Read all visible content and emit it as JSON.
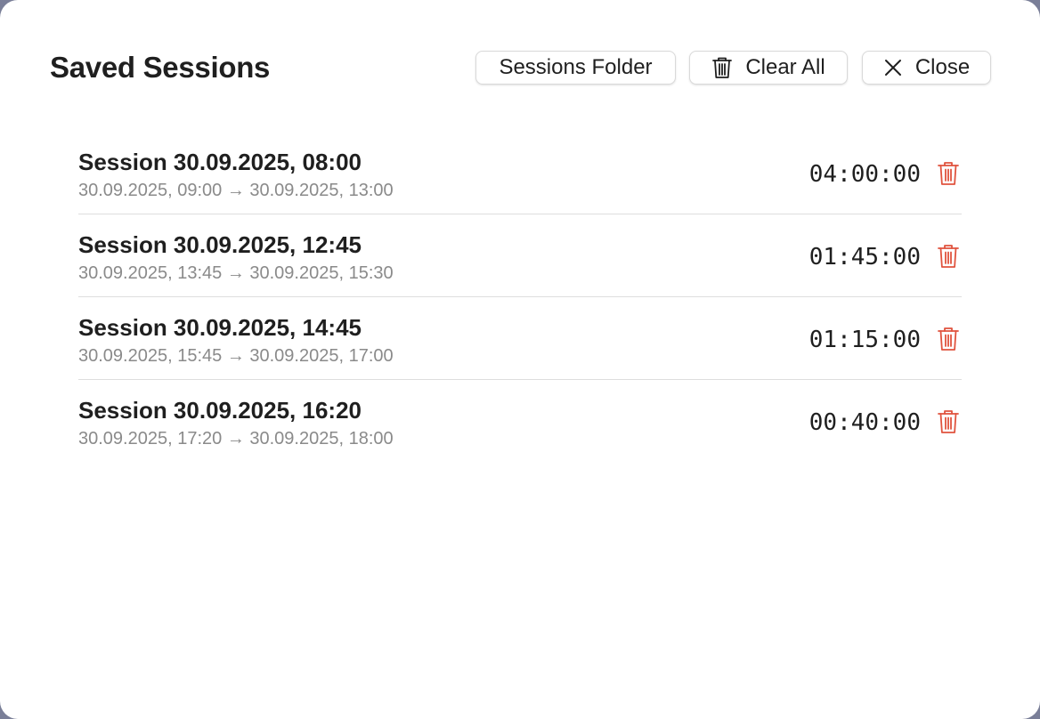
{
  "header": {
    "title": "Saved Sessions",
    "sessions_folder_label": "Sessions Folder",
    "clear_all_label": "Clear All",
    "close_label": "Close"
  },
  "icons": {
    "clear_all": "trash-icon",
    "close": "close-icon",
    "row_delete": "trash-icon"
  },
  "colors": {
    "delete_accent": "#e0533e"
  },
  "sessions": [
    {
      "title": "Session 30.09.2025, 08:00",
      "range": "30.09.2025, 09:00 → 30.09.2025, 13:00",
      "duration": "04:00:00"
    },
    {
      "title": "Session 30.09.2025, 12:45",
      "range": "30.09.2025, 13:45 → 30.09.2025, 15:30",
      "duration": "01:45:00"
    },
    {
      "title": "Session 30.09.2025, 14:45",
      "range": "30.09.2025, 15:45 → 30.09.2025, 17:00",
      "duration": "01:15:00"
    },
    {
      "title": "Session 30.09.2025, 16:20",
      "range": "30.09.2025, 17:20 → 30.09.2025, 18:00",
      "duration": "00:40:00"
    }
  ]
}
